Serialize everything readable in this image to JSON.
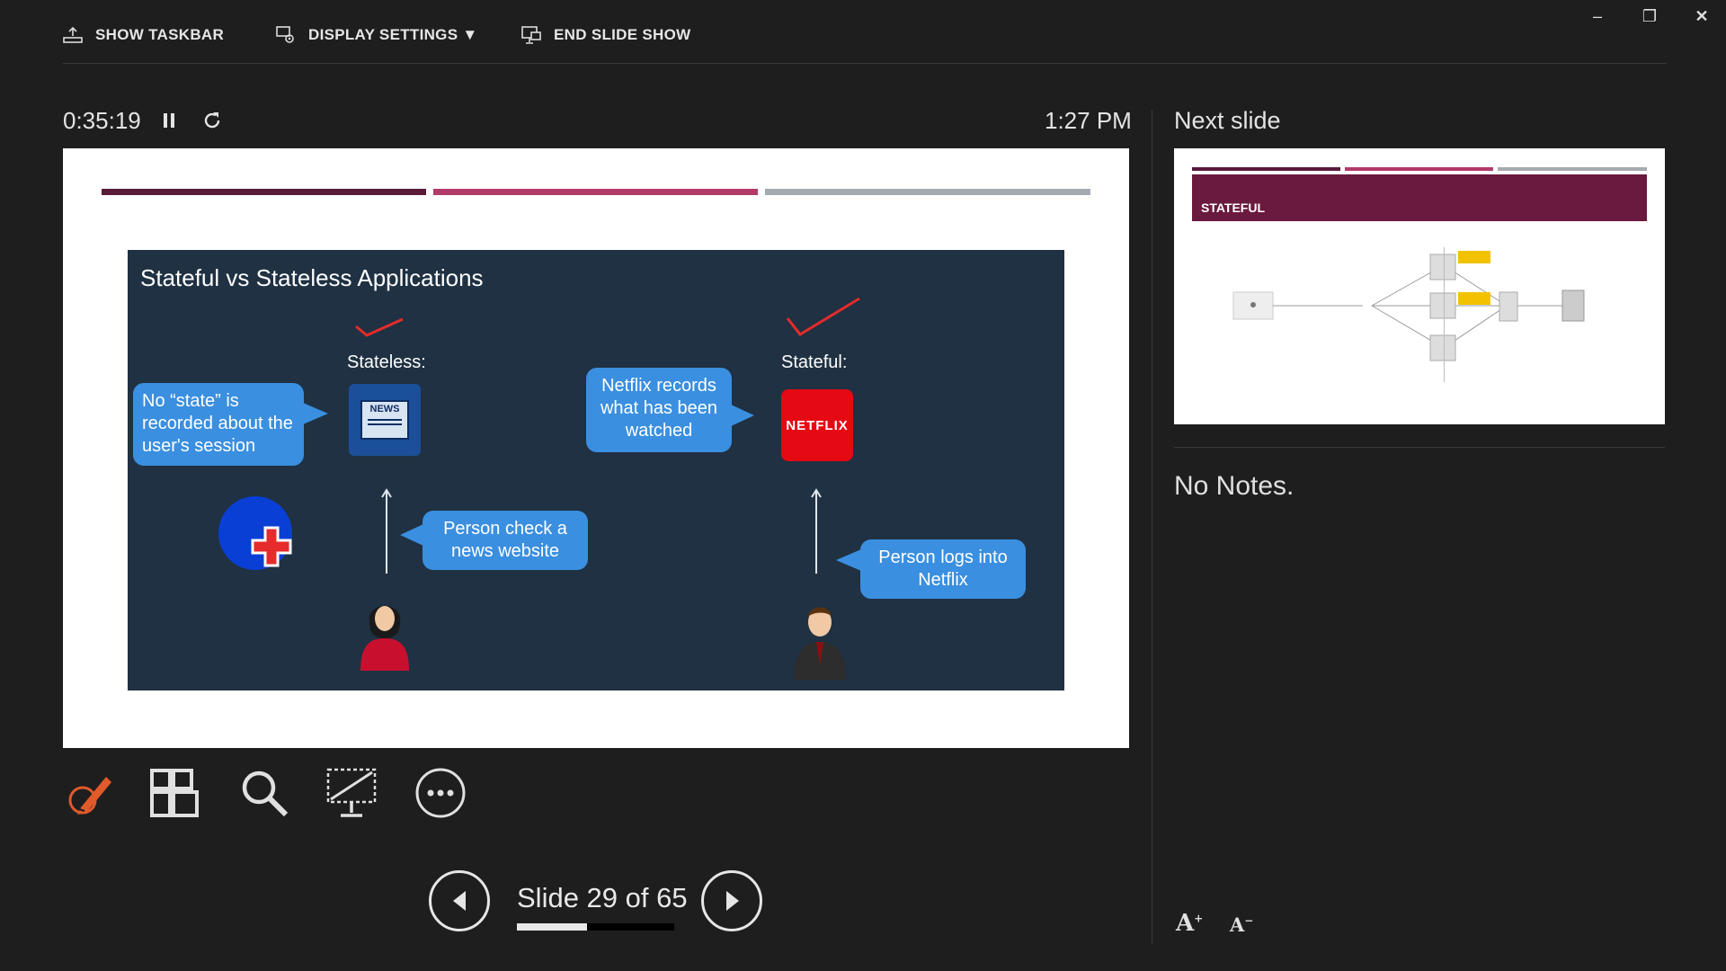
{
  "toolbar": {
    "show_taskbar": "SHOW TASKBAR",
    "display_settings": "DISPLAY SETTINGS ▼",
    "end_slide_show": "END SLIDE SHOW"
  },
  "timer": {
    "elapsed": "0:35:19",
    "clock": "1:27 PM"
  },
  "slide": {
    "title": "Stateful vs Stateless Applications",
    "stateless_label": "Stateless:",
    "stateful_label": "Stateful:",
    "no_state_bubble": "No “state” is recorded about the user's session",
    "netflix_bubble": "Netflix records what has been watched",
    "news_bubble": "Person check a news website",
    "logs_bubble": "Person logs into Netflix",
    "news_icon_text": "NEWS",
    "netflix_logo_text": "NETFLIX",
    "header_bar_colors": [
      "#5a1a3a",
      "#b23a6b",
      "#a3aab0"
    ],
    "content_bg": "#1f3142",
    "bubble_color": "#3a8fe0"
  },
  "next_slide": {
    "label": "Next slide",
    "thumb_title": "STATEFUL",
    "thumb_header_color": "#6a1a3e"
  },
  "notes": {
    "text": "No Notes."
  },
  "tools": [
    "pen-tool",
    "see-all-slides",
    "zoom",
    "black-screen",
    "more-options"
  ],
  "nav": {
    "slide_counter": "Slide 29 of 65",
    "progress": 0.446
  },
  "accent": "#e05a2b"
}
